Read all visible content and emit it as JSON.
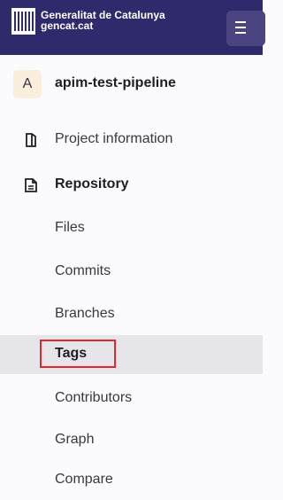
{
  "header": {
    "brand_line1": "Generalitat de Catalunya",
    "brand_line2": "gencat.cat",
    "logo_icon": "gencat-logo",
    "menu_icon": "hamburger-menu-icon"
  },
  "project": {
    "avatar_letter": "A",
    "name": "apim-test-pipeline"
  },
  "nav": {
    "project_information": "Project information",
    "repository": "Repository"
  },
  "repository_items": [
    {
      "label": "Files"
    },
    {
      "label": "Commits"
    },
    {
      "label": "Branches"
    },
    {
      "label": "Tags"
    },
    {
      "label": "Contributors"
    },
    {
      "label": "Graph"
    },
    {
      "label": "Compare"
    }
  ],
  "active_item": "Tags",
  "colors": {
    "topbar": "#2f2a6b",
    "active_bg": "#e6e5ea",
    "highlight_border": "#e3262c"
  }
}
